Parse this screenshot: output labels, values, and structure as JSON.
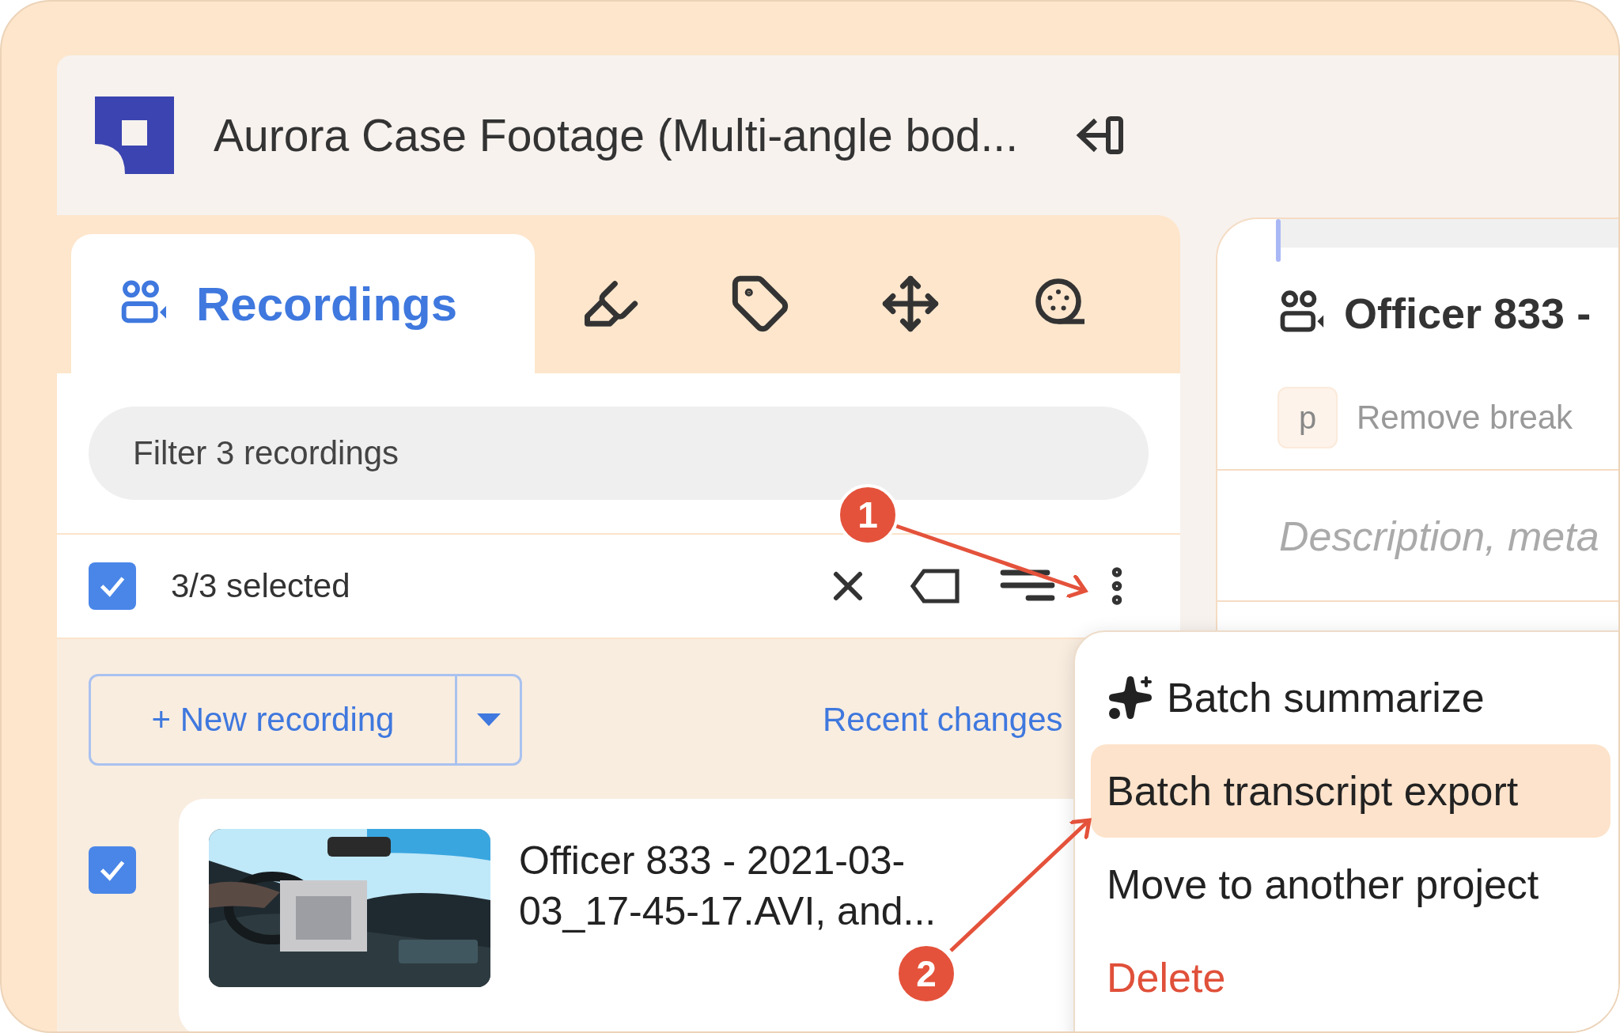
{
  "header": {
    "title": "Aurora Case Footage (Multi-angle bod..."
  },
  "tabs": [
    {
      "kind": "recordings",
      "label": "Recordings",
      "selected": true
    },
    {
      "kind": "highlight",
      "selected": false
    },
    {
      "kind": "tag",
      "selected": false
    },
    {
      "kind": "move",
      "selected": false
    },
    {
      "kind": "reel",
      "selected": false
    }
  ],
  "filter": {
    "placeholder": "Filter 3 recordings"
  },
  "selection": {
    "checked": true,
    "label": "3/3 selected"
  },
  "new_recording": {
    "label": "+ New recording"
  },
  "recent_changes": "Recent changes",
  "recordings": [
    {
      "checked": true,
      "title": "Officer 833 - 2021-03-03_17-45-17.AVI, and..."
    }
  ],
  "detail": {
    "title": "Officer 833 -",
    "shortcut_key": "p",
    "shortcut_label": "Remove break",
    "description_placeholder": "Description, meta"
  },
  "menu": [
    {
      "kind": "ai",
      "label": "Batch summarize",
      "selected": false
    },
    {
      "kind": "plain",
      "label": "Batch transcript export",
      "selected": true
    },
    {
      "kind": "plain",
      "label": "Move to another project",
      "selected": false
    },
    {
      "kind": "danger",
      "label": "Delete",
      "selected": false
    }
  ],
  "callouts": [
    {
      "label": "1"
    },
    {
      "label": "2"
    }
  ]
}
